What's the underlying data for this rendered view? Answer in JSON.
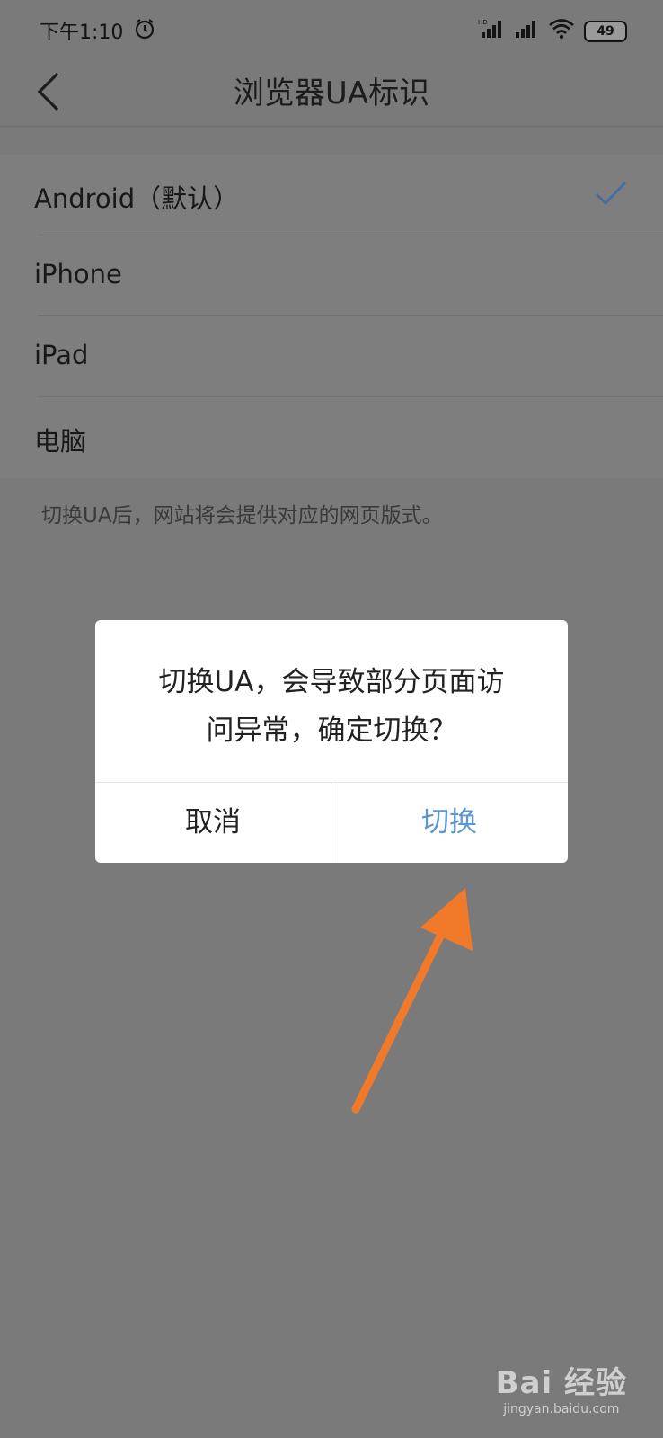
{
  "status_bar": {
    "time": "下午1:10",
    "battery": "49",
    "icons": [
      "alarm-icon",
      "hd-signal-icon",
      "signal-icon",
      "wifi-icon",
      "battery-icon"
    ]
  },
  "header": {
    "title": "浏览器UA标识",
    "back_icon": "chevron-left-icon"
  },
  "ua_options": {
    "items": [
      {
        "label": "Android（默认）",
        "selected": true
      },
      {
        "label": "iPhone",
        "selected": false
      },
      {
        "label": "iPad",
        "selected": false
      },
      {
        "label": "电脑",
        "selected": false
      }
    ],
    "hint": "切换UA后，网站将会提供对应的网页版式。"
  },
  "dialog": {
    "line1": "切换UA，会导致部分页面访",
    "line2": "问异常，确定切换？",
    "cancel_label": "取消",
    "confirm_label": "切换"
  },
  "colors": {
    "accent": "#5a97d2",
    "annotation_arrow": "#f07a2a",
    "overlay": "#7a7a7a"
  },
  "watermark": {
    "logo_text": "Bai 经验",
    "url": "jingyan.baidu.com"
  }
}
